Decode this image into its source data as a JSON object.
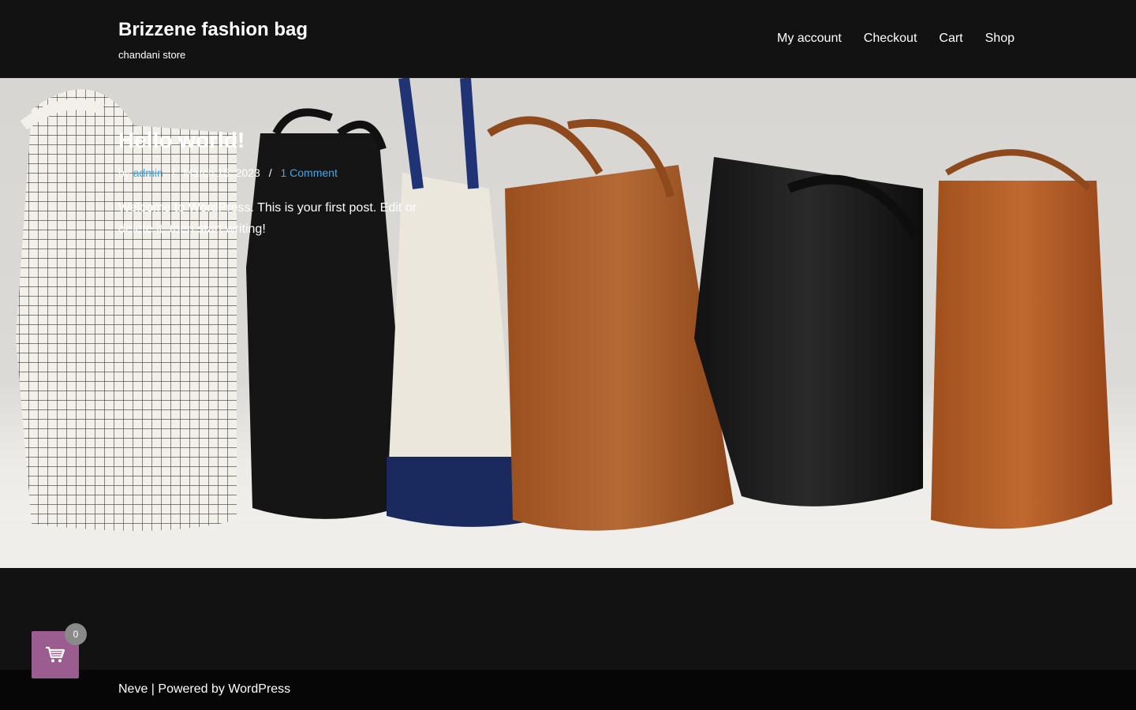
{
  "header": {
    "site_title": "Brizzene fashion bag",
    "tagline": "chandani store",
    "nav": [
      {
        "label": "My account"
      },
      {
        "label": "Checkout"
      },
      {
        "label": "Cart"
      },
      {
        "label": "Shop"
      }
    ]
  },
  "post": {
    "title": "Hello world!",
    "meta": {
      "by": "by",
      "author": "admin",
      "separator": "/",
      "date": "March 15, 2023",
      "comments": "1 Comment"
    },
    "excerpt": "Welcome to WordPress. This is your first post. Edit or delete it, then start writing!"
  },
  "footer": {
    "theme_link": "Neve",
    "separator": " | Powered by ",
    "wp_link": "WordPress"
  },
  "cart": {
    "icon": "shopping-cart-icon",
    "count": "0"
  },
  "colors": {
    "background": "#121212",
    "link": "#3fa8ec",
    "cart_widget": "#9b5c8f"
  }
}
